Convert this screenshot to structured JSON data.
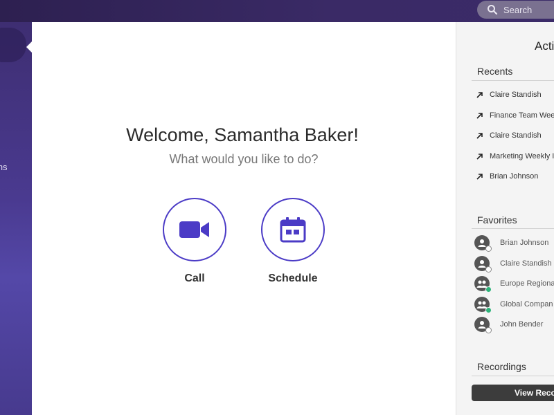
{
  "header": {
    "search": {
      "label": "Search",
      "icon": "search-icon"
    }
  },
  "sidebar": {
    "partial_label": "ems"
  },
  "main": {
    "welcome": "Welcome, Samantha Baker!",
    "subtitle": "What would you like to do?",
    "actions": [
      {
        "label": "Call",
        "icon": "video-camera-icon"
      },
      {
        "label": "Schedule",
        "icon": "calendar-icon"
      }
    ]
  },
  "right_panel": {
    "title": "Acti",
    "recents": {
      "header": "Recents",
      "items": [
        {
          "label": "Claire Standish"
        },
        {
          "label": "Finance Team Wee"
        },
        {
          "label": "Claire Standish"
        },
        {
          "label": "Marketing Weekly I"
        },
        {
          "label": "Brian Johnson"
        }
      ]
    },
    "favorites": {
      "header": "Favorites",
      "items": [
        {
          "label": "Brian Johnson",
          "type": "person",
          "status": "away"
        },
        {
          "label": "Claire Standish",
          "type": "person",
          "status": "away"
        },
        {
          "label": "Europe Regiona",
          "type": "group",
          "status": "online"
        },
        {
          "label": "Global Compan",
          "type": "group",
          "status": "online"
        },
        {
          "label": "John Bender",
          "type": "person",
          "status": "away"
        }
      ]
    },
    "recordings": {
      "header": "Recordings",
      "button": "View Reco"
    }
  },
  "colors": {
    "accent": "#4b3bc6",
    "header_bg": "#2d2050",
    "sidebar_bg": "#4a3a90",
    "online": "#2db37a",
    "button_dark": "#3c3c3c"
  }
}
